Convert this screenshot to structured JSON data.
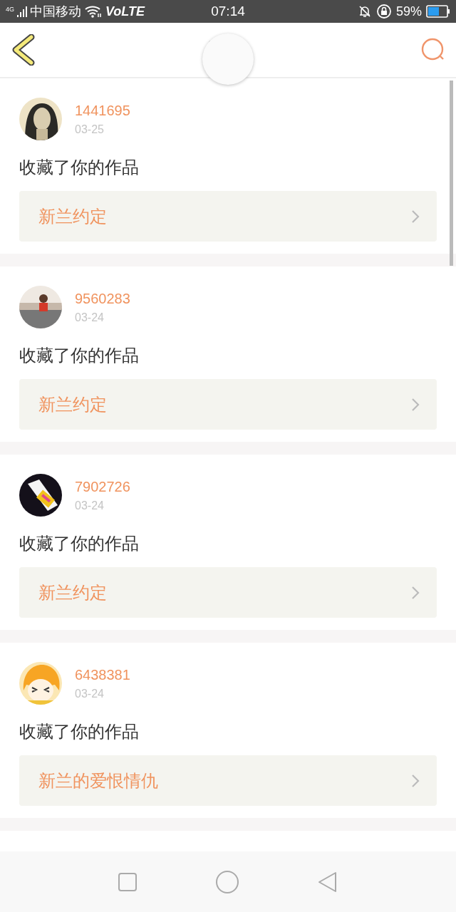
{
  "status_bar": {
    "network": "4G",
    "carrier": "中国移动",
    "volte": "VoLTE",
    "time": "07:14",
    "battery": "59%"
  },
  "notifications": [
    {
      "user": "1441695",
      "date": "03-25",
      "action": "收藏了你的作品",
      "work": "新兰约定"
    },
    {
      "user": "9560283",
      "date": "03-24",
      "action": "收藏了你的作品",
      "work": "新兰约定"
    },
    {
      "user": "7902726",
      "date": "03-24",
      "action": "收藏了你的作品",
      "work": "新兰约定"
    },
    {
      "user": "6438381",
      "date": "03-24",
      "action": "收藏了你的作品",
      "work": "新兰的爱恨情仇"
    }
  ]
}
